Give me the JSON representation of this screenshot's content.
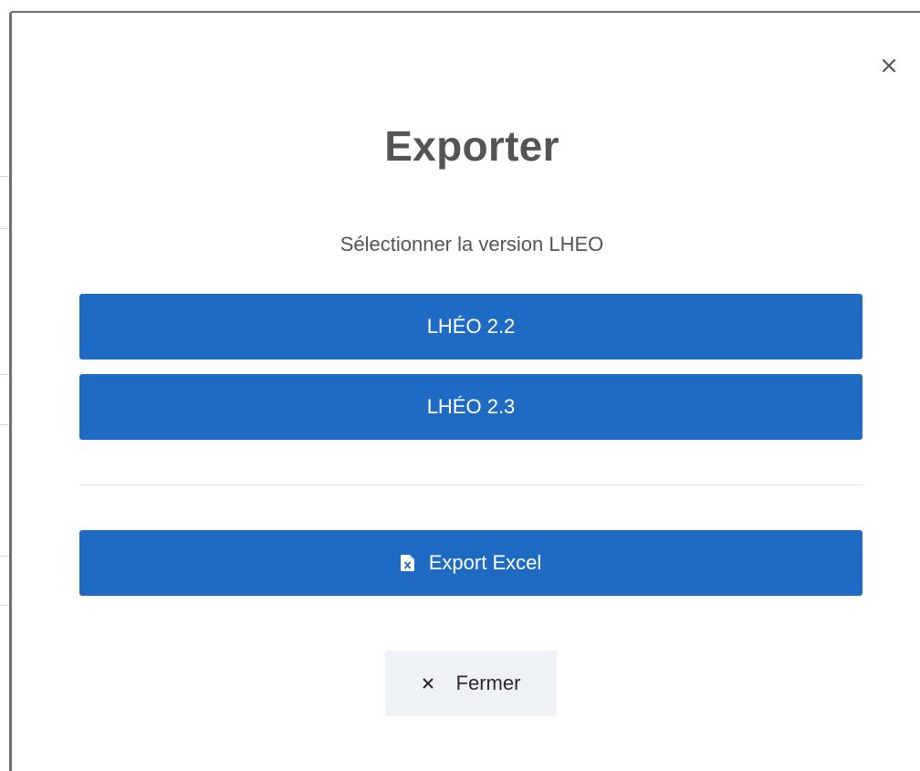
{
  "modal": {
    "title": "Exporter",
    "subtitle": "Sélectionner la version LHEO",
    "close_icon": "close-icon"
  },
  "versions": [
    {
      "label": "LHÉO 2.2"
    },
    {
      "label": "LHÉO 2.3"
    }
  ],
  "export_excel": {
    "label": "Export Excel",
    "icon": "excel-file-icon"
  },
  "close_button": {
    "label": "Fermer",
    "icon": "close-icon"
  },
  "colors": {
    "primary": "#1f6bc4",
    "secondary_bg": "#eef1f6",
    "title_text": "#545454"
  }
}
